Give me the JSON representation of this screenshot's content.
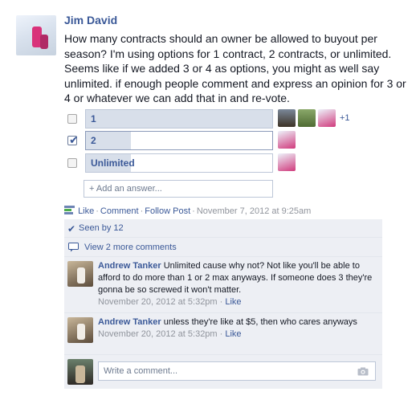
{
  "post": {
    "author": "Jim David",
    "text": "How many contracts should an owner be allowed to buyout per season? I'm using options for 1 contract, 2 contracts, or unlimited. Seems like if we added 3 or 4 as options, you might as well say unlimited. if enough people comment and express an opinion for 3 or 4 or whatever we can add that in and re-vote."
  },
  "poll": {
    "options": [
      {
        "label": "1",
        "checked": false,
        "fill_fraction": 1.0,
        "voters_more": "+1"
      },
      {
        "label": "2",
        "checked": true,
        "fill_fraction": 0.24
      },
      {
        "label": "Unlimited",
        "checked": false,
        "fill_fraction": 0.24
      }
    ],
    "add_answer_placeholder": "+ Add an answer..."
  },
  "actions": {
    "like": "Like",
    "comment": "Comment",
    "follow": "Follow Post",
    "timestamp": "November 7, 2012 at 9:25am"
  },
  "ufi": {
    "seen_by": "Seen by 12",
    "view_more": "View 2 more comments",
    "comments": [
      {
        "author": "Andrew Tanker",
        "text": "Unlimited cause why not? Not like you'll be able to afford to do more than 1 or 2 max anyways. If someone does 3 they're gonna be so screwed it won't matter.",
        "time": "November 20, 2012 at 5:32pm",
        "like": "Like"
      },
      {
        "author": "Andrew Tanker",
        "text": "unless they're like at $5, then who cares anyways",
        "time": "November 20, 2012 at 5:32pm",
        "like": "Like"
      }
    ],
    "write_placeholder": "Write a comment..."
  },
  "colors": {
    "link": "#3b5998",
    "ufi_bg": "#edeff4",
    "bar_fill": "#d8dfea",
    "meta": "#90949c"
  },
  "icons": {
    "seen": "checkmark-icon",
    "view_more": "speech-bubble-icon",
    "poll": "poll-icon",
    "camera": "camera-icon"
  }
}
